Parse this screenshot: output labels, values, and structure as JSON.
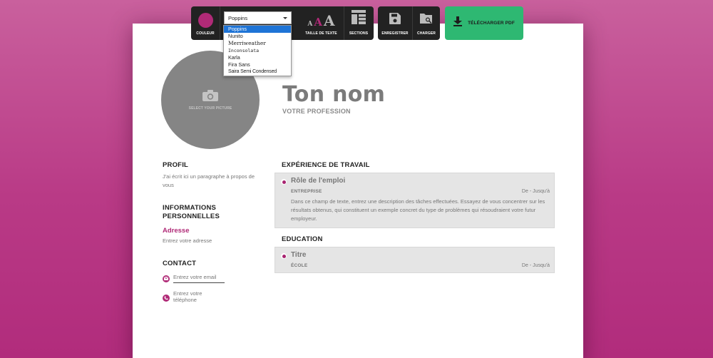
{
  "colors": {
    "accent": "#b02a77",
    "download_button": "#2eb872",
    "toolbar": "#222222",
    "background_top": "#c9609d",
    "background_bottom": "#b12c7c"
  },
  "toolbar": {
    "color_label": "COULEUR",
    "font_selected": "Poppins",
    "font_options": [
      "Poppins",
      "Nunito",
      "Merriweather",
      "Inconsolata",
      "Karla",
      "Fira Sans",
      "Saira Semi Condensed"
    ],
    "text_size_label": "TAILLE DE TEXTE",
    "sections_label": "SECTIONS",
    "save_label": "ENREGISTRER",
    "load_label": "CHARGER",
    "pdf_label": "TÉLÉCHARGER PDF"
  },
  "cv": {
    "photo_label": "SELECT YOUR PICTURE",
    "name": "Ton nom",
    "profession": "VOTRE PROFESSION",
    "profile": {
      "title": "PROFIL",
      "text": "J'ai écrit ici un paragraphe à propos de vous"
    },
    "personal": {
      "title": "INFORMATIONS PERSONNELLES",
      "address_label": "Adresse",
      "address_placeholder": "Entrez votre adresse"
    },
    "contact": {
      "title": "CONTACT",
      "email_placeholder": "Entrez votre email",
      "phone_placeholder": "Entrez votre téléphone"
    },
    "experience": {
      "title": "EXPÉRIENCE DE TRAVAIL",
      "role": "Rôle de l'emploi",
      "company": "ENTREPRISE",
      "dates": "De - Jusqu'à",
      "description": "Dans ce champ de texte, entrez une description des tâches effectuées. Essayez de vous concentrer sur les résultats obtenus, qui constituent un exemple concret du type de problèmes qui résoudraient votre futur employeur."
    },
    "education": {
      "title": "EDUCATION",
      "degree": "Titre",
      "school": "ÉCOLE",
      "dates": "De - Jusqu'à"
    }
  }
}
